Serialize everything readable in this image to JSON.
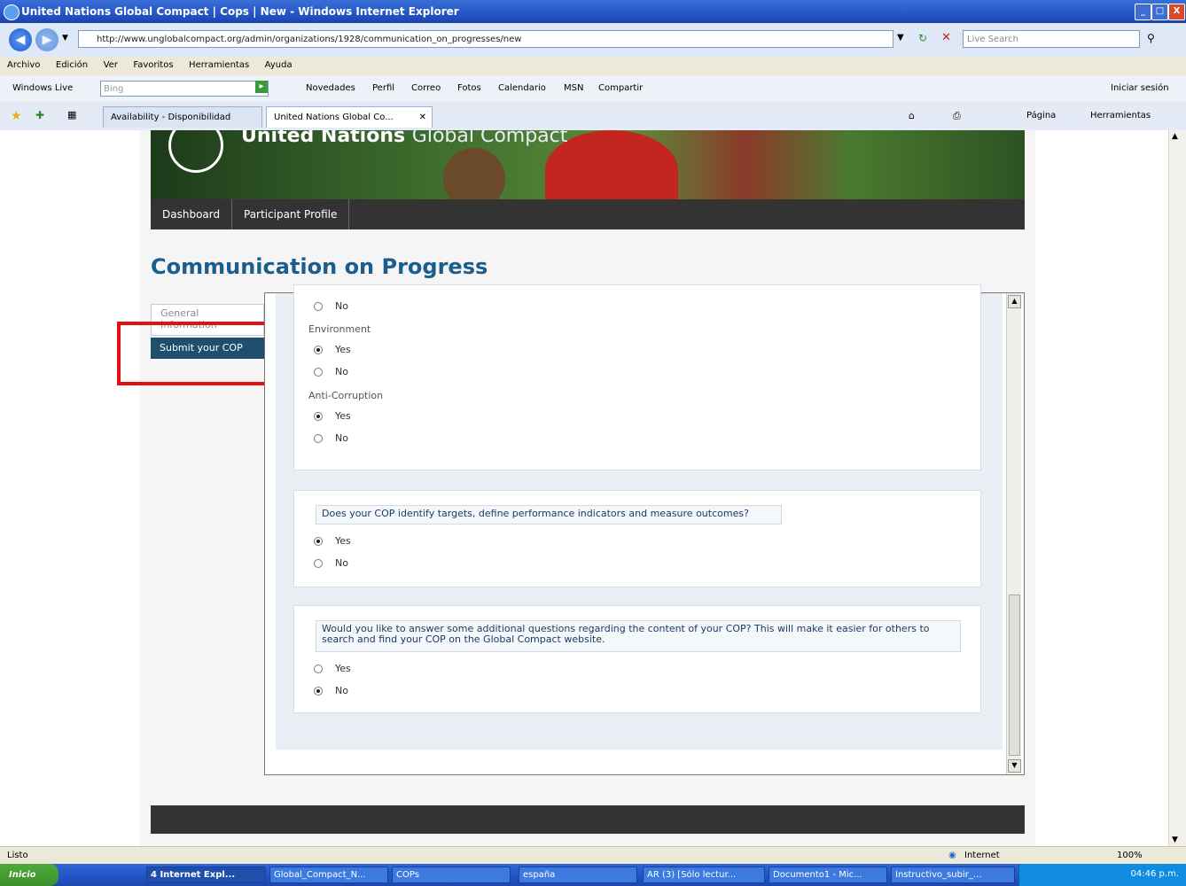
{
  "window": {
    "title": "United Nations Global Compact | Cops | New - Windows Internet Explorer",
    "min": "_",
    "max": "□",
    "close": "X"
  },
  "address": {
    "url": "http://www.unglobalcompact.org/admin/organizations/1928/communication_on_progresses/new",
    "search_placeholder": "Live Search"
  },
  "menu": [
    "Archivo",
    "Edición",
    "Ver",
    "Favoritos",
    "Herramientas",
    "Ayuda"
  ],
  "live_toolbar": {
    "brand": "Windows Live",
    "search_placeholder": "Bing",
    "items": [
      "Novedades",
      "Perfil",
      "Correo",
      "Fotos",
      "Calendario",
      "MSN",
      "Compartir"
    ],
    "signin": "Iniciar sesión"
  },
  "tabs": {
    "tab1": "Availability - Disponibilidad",
    "tab2": "United Nations Global Co...",
    "page_menu": "Página",
    "tools_menu": "Herramientas"
  },
  "site": {
    "brand_un": "United Nations",
    "brand_gc": "Global Compact",
    "nav": [
      "Dashboard",
      "Participant Profile"
    ],
    "page_title": "Communication on Progress",
    "side_tabs": {
      "general": "General Information",
      "submit": "Submit your COP"
    }
  },
  "form": {
    "group1_no": "No",
    "environment_label": "Environment",
    "environment_yes": "Yes",
    "environment_no": "No",
    "anticorruption_label": "Anti-Corruption",
    "anticorruption_yes": "Yes",
    "anticorruption_no": "No",
    "q_targets": "Does your COP identify targets, define performance indicators and measure outcomes?",
    "q_targets_yes": "Yes",
    "q_targets_no": "No",
    "q_additional": "Would you like to answer some additional questions regarding the content of your COP? This will make it easier for others to search and find your COP on the Global Compact website.",
    "q_additional_yes": "Yes",
    "q_additional_no": "No"
  },
  "status": {
    "left": "Listo",
    "zone": "Internet",
    "zoom": "100%"
  },
  "taskbar": {
    "start": "Inicio",
    "buttons": [
      "4 Internet Expl...",
      "Global_Compact_N...",
      "COPs",
      "españa",
      "AR (3) [Sólo lectur...",
      "Documento1 - Mic...",
      "Instructivo_subir_..."
    ],
    "clock": "04:46 p.m."
  }
}
